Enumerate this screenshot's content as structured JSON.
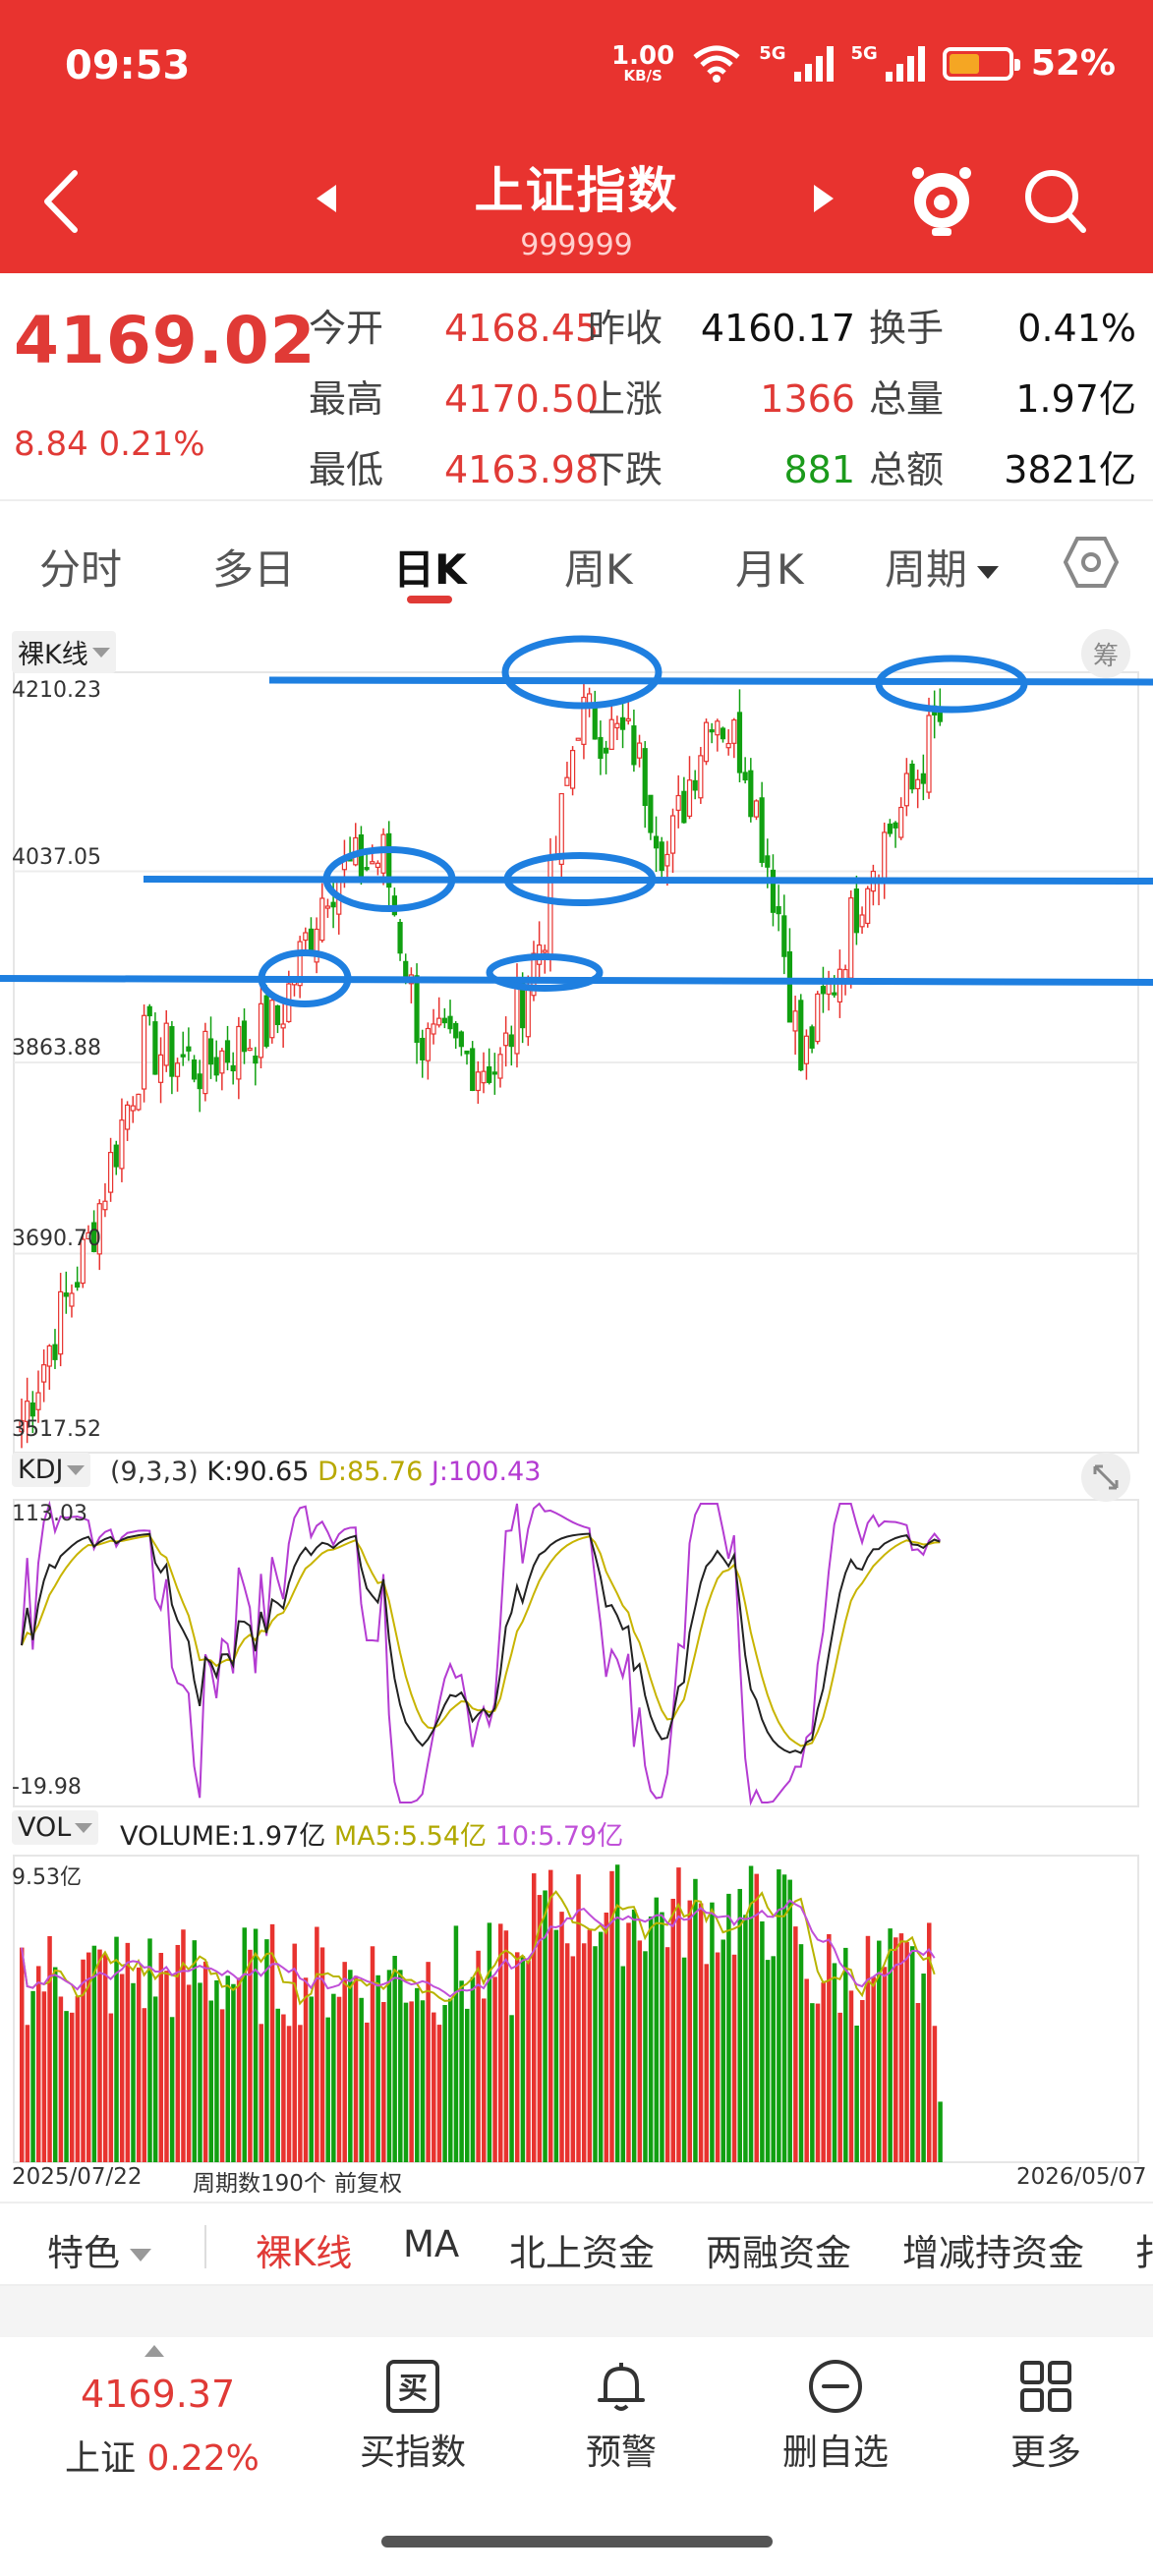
{
  "status_bar": {
    "time": "09:53",
    "net_speed": "1.00",
    "net_unit": "KB/S",
    "net1": "5G",
    "net2": "5G",
    "battery": "52%",
    "battery_level": 0.52
  },
  "header": {
    "title": "上证指数",
    "code": "999999"
  },
  "quote": {
    "price": "4169.02",
    "change": "8.84 0.21%",
    "rows": [
      {
        "l1": "今开",
        "v1": "4168.45",
        "l2": "昨收",
        "v2": "4160.17",
        "l3": "换手",
        "v3": "0.41%"
      },
      {
        "l1": "最高",
        "v1": "4170.50",
        "l2": "上涨",
        "v2": "1366",
        "l3": "总量",
        "v3": "1.97亿"
      },
      {
        "l1": "最低",
        "v1": "4163.98",
        "l2": "下跌",
        "v2": "881",
        "l3": "总额",
        "v3": "3821亿"
      }
    ]
  },
  "tabs": [
    "分时",
    "多日",
    "日K",
    "周K",
    "月K",
    "周期"
  ],
  "kline": {
    "badge": "裸K线",
    "chou": "筹",
    "y_labels": [
      "4210.23",
      "4037.05",
      "3863.88",
      "3690.70",
      "3517.52"
    ],
    "y_max": 4210.23,
    "y_min": 3517.52
  },
  "kdj": {
    "badge": "KDJ",
    "params": "(9,3,3)",
    "k": "K:90.65",
    "d": "D:85.76",
    "j": "J:100.43",
    "y_max": "113.03",
    "y_min": "-19.98",
    "colors": {
      "k": "#222222",
      "d": "#c8b400",
      "j": "#b43cd2"
    }
  },
  "vol": {
    "badge": "VOL",
    "volume": "VOLUME:1.97亿",
    "ma5": "MA5:5.54亿",
    "ma10": "10:5.79亿",
    "y_max": "9.53亿",
    "colors": {
      "up": "#e8332f",
      "down": "#11a011",
      "ma5": "#b8b400",
      "ma10": "#c050d8"
    }
  },
  "dates": {
    "start": "2025/07/22",
    "period": "周期数190个",
    "adjust": "前复权",
    "end": "2026/05/07"
  },
  "feature_tabs": [
    "特色",
    "裸K线",
    "MA",
    "北上资金",
    "两融资金",
    "增减持资金",
    "扌"
  ],
  "bottom": {
    "price": "4169.37",
    "name": "上证",
    "pct": "0.22%",
    "actions": [
      {
        "label": "买指数",
        "icon": "buy-icon",
        "glyph": "买"
      },
      {
        "label": "预警",
        "icon": "bell-icon"
      },
      {
        "label": "删自选",
        "icon": "remove-watchlist-icon"
      },
      {
        "label": "更多",
        "icon": "grid-icon"
      }
    ]
  },
  "chart_data": {
    "type": "candlestick",
    "ylim": [
      3517.52,
      4210.23
    ],
    "period_count": 190,
    "x_range": [
      "2025/07/22",
      "2026/05/07"
    ],
    "key_points": [
      {
        "x": 0,
        "y": 3540
      },
      {
        "x": 12,
        "y": 3700
      },
      {
        "x": 22,
        "y": 3880
      },
      {
        "x": 32,
        "y": 3860
      },
      {
        "x": 46,
        "y": 3900
      },
      {
        "x": 55,
        "y": 4030
      },
      {
        "x": 65,
        "y": 4050
      },
      {
        "x": 72,
        "y": 3880
      },
      {
        "x": 86,
        "y": 3860
      },
      {
        "x": 94,
        "y": 3990
      },
      {
        "x": 100,
        "y": 4180
      },
      {
        "x": 110,
        "y": 4150
      },
      {
        "x": 116,
        "y": 4050
      },
      {
        "x": 124,
        "y": 4190
      },
      {
        "x": 130,
        "y": 4140
      },
      {
        "x": 136,
        "y": 4000
      },
      {
        "x": 140,
        "y": 3860
      },
      {
        "x": 146,
        "y": 3940
      },
      {
        "x": 152,
        "y": 4040
      },
      {
        "x": 160,
        "y": 4110
      },
      {
        "x": 164,
        "y": 4169
      }
    ],
    "support_lines": [
      4210.23,
      4037.05,
      3940
    ],
    "kdj_range": [
      -19.98,
      113.03
    ]
  }
}
